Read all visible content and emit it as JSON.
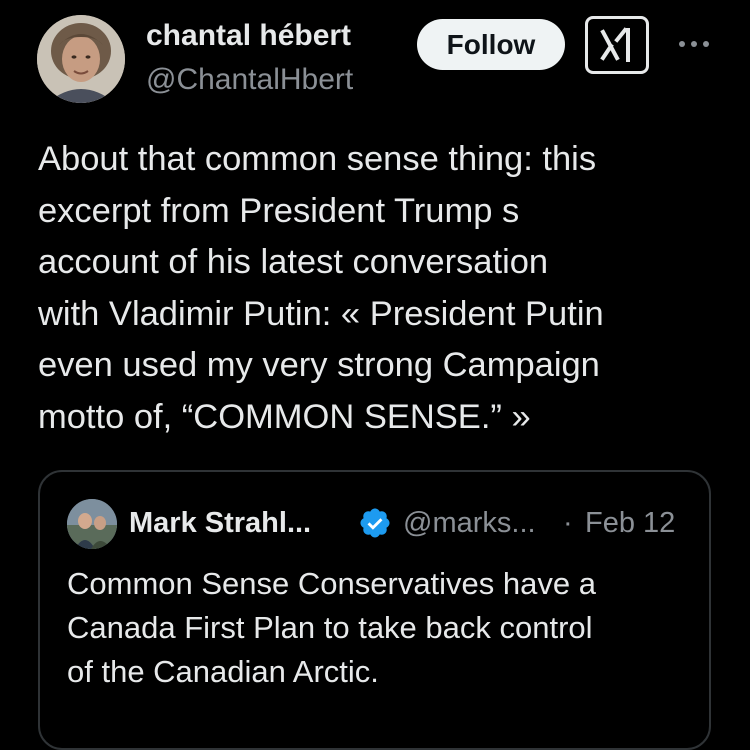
{
  "tweet": {
    "author": {
      "name": "chantal hébert",
      "handle": "@ChantalHbert"
    },
    "follow_label": "Follow",
    "grok_icon": "grok-icon",
    "more_icon": "more-horizontal-icon",
    "text": "About that common sense thing: this\nexcerpt from President Trump s\naccount of his latest conversation\nwith Vladimir Putin: « President Putin\neven used my very strong Campaign\nmotto of, “COMMON SENSE.” »"
  },
  "quote": {
    "author": {
      "name": "Mark Strahl...",
      "handle": "@marks...",
      "verified": true
    },
    "separator": "·",
    "date": "Feb 12",
    "text": "Common Sense Conservatives have a\nCanada First Plan to take back control\nof the Canadian Arctic."
  },
  "colors": {
    "background": "#000000",
    "text_primary": "#e7e9ea",
    "text_secondary": "#8b9096",
    "verified_blue": "#1d9bf0",
    "border": "#2f3336",
    "follow_bg": "#eff3f4"
  }
}
